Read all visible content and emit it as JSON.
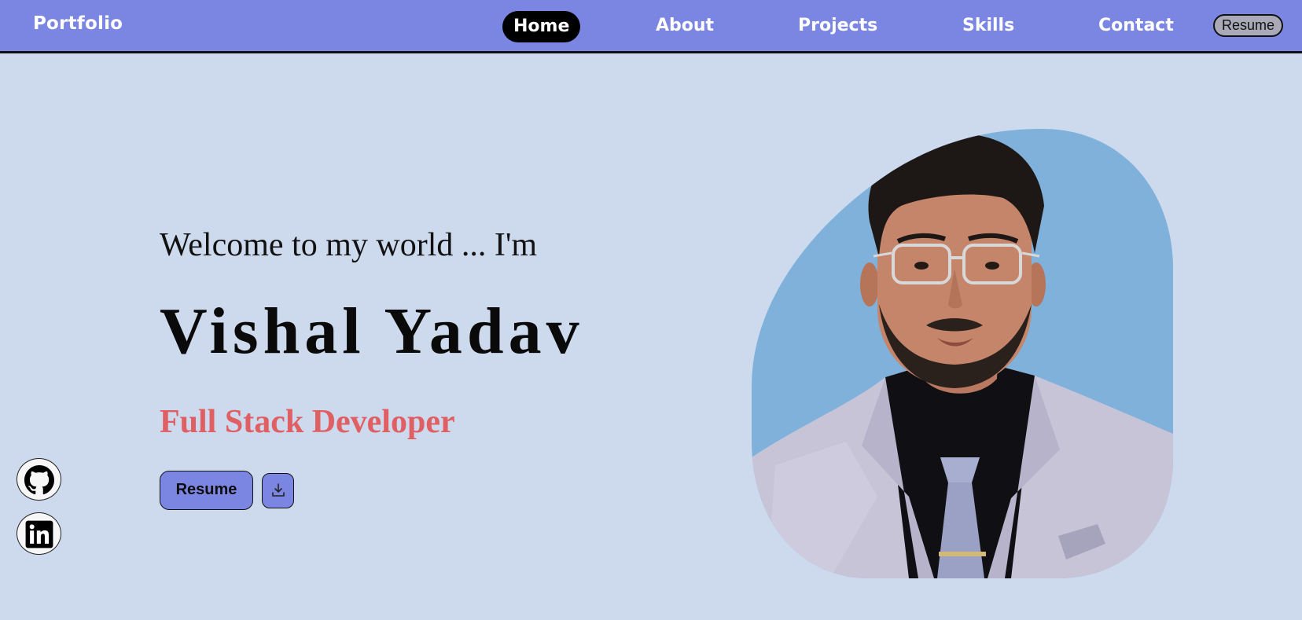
{
  "nav": {
    "brand": "Portfolio",
    "links": [
      {
        "label": "Home",
        "active": true
      },
      {
        "label": "About",
        "active": false
      },
      {
        "label": "Projects",
        "active": false
      },
      {
        "label": "Skills",
        "active": false
      },
      {
        "label": "Contact",
        "active": false
      }
    ],
    "resume_label": "Resume"
  },
  "hero": {
    "welcome": "Welcome to my world ... I'm",
    "name": "Vishal Yadav",
    "role": "Full Stack Developer",
    "resume_button": "Resume",
    "download_icon": "download-icon"
  },
  "social": [
    {
      "icon": "github-icon"
    },
    {
      "icon": "linkedin-icon"
    }
  ],
  "colors": {
    "navbar": "#7b86e2",
    "background": "#cdd9ec",
    "role_text": "#e05f63",
    "portrait_blob": "#7fb1da"
  }
}
